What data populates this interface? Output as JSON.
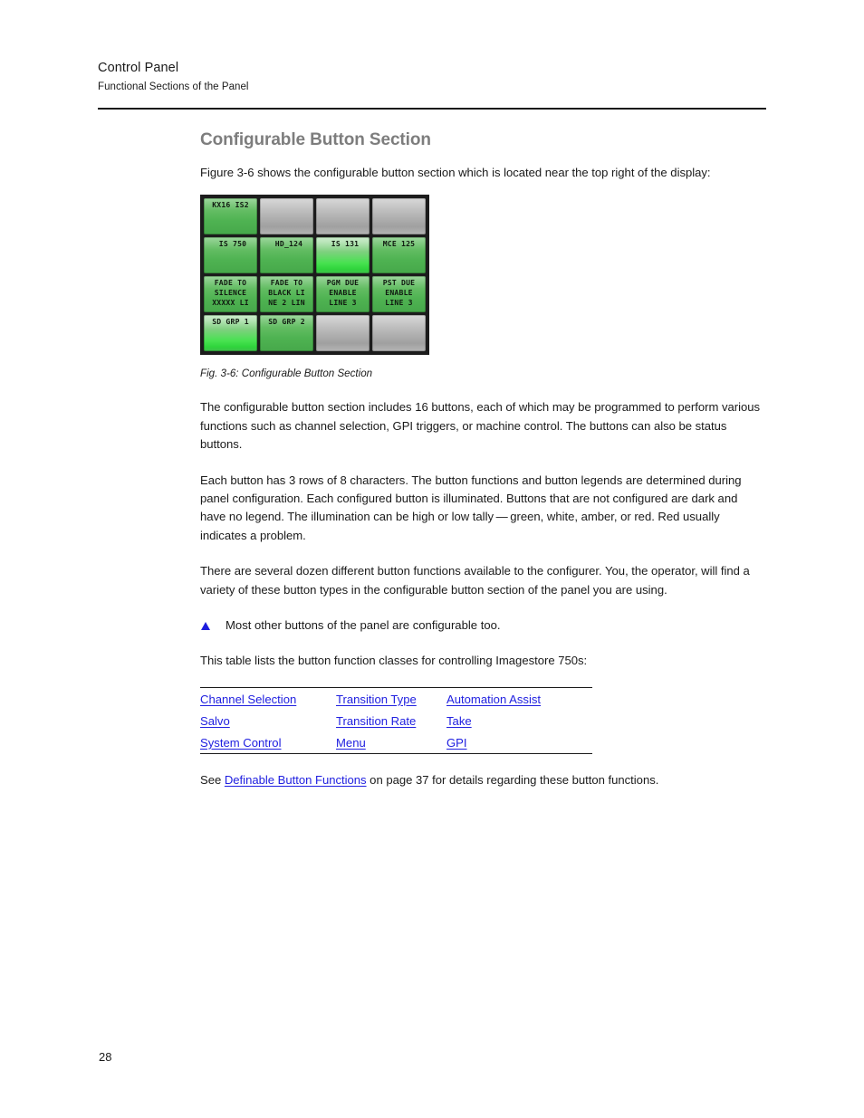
{
  "header": {
    "title": "Control Panel",
    "subtitle": "Functional Sections of the Panel"
  },
  "section": {
    "heading": "Configurable Button Section",
    "intro": "Figure 3-6 shows the configurable button section which is located near the top right of the display:",
    "caption": "Fig. 3-6: Configurable Button Section",
    "para1": "The configurable button section includes 16 buttons, each of which may be programmed to perform various functions such as channel selection, GPI triggers, or machine control. The buttons can also be status buttons.",
    "para2": "Each button has 3 rows of 8 characters. The button functions and button legends are determined during panel configuration. Each configured button is illuminated. Buttons that are not configured are dark and have no legend. The illumination can be high or low tally — green, white, amber, or red. Red usually indicates a problem.",
    "para3": "There are several dozen different button functions available to the configurer. You, the operator, will find a variety of these button types in the configurable button section of the panel you are using.",
    "note": "Most other buttons of the panel are configurable too.",
    "table_intro": "This table lists the button function classes for controlling Imagestore 750s:",
    "see_prefix": "See ",
    "see_link": "Definable Button Functions",
    "see_suffix": " on page 37 for details regarding these button functions."
  },
  "figure": {
    "panel_background": "#1c1c1c",
    "buttons": [
      {
        "state": "green",
        "lines": "KX16 IS2"
      },
      {
        "state": "gray",
        "lines": ""
      },
      {
        "state": "gray",
        "lines": ""
      },
      {
        "state": "gray",
        "lines": ""
      },
      {
        "state": "green",
        "lines": " IS 750"
      },
      {
        "state": "green",
        "lines": " HD_124"
      },
      {
        "state": "green-hi",
        "lines": " IS 131"
      },
      {
        "state": "green",
        "lines": "MCE 125"
      },
      {
        "state": "green",
        "lines": "FADE TO\nSILENCE\nXXXXX LI"
      },
      {
        "state": "green",
        "lines": "FADE TO\nBLACK LI\nNE 2 LIN"
      },
      {
        "state": "green",
        "lines": "PGM DUE\nENABLE\nLINE 3"
      },
      {
        "state": "green",
        "lines": "PST DUE\nENABLE\nLINE 3"
      },
      {
        "state": "green-hi",
        "lines": "SD GRP 1"
      },
      {
        "state": "green",
        "lines": "SD GRP 2"
      },
      {
        "state": "gray",
        "lines": ""
      },
      {
        "state": "gray",
        "lines": ""
      }
    ]
  },
  "link_table": {
    "rows": [
      [
        "Channel Selection",
        "Transition Type",
        "Automation Assist"
      ],
      [
        "Salvo",
        "Transition Rate",
        "Take"
      ],
      [
        "System Control",
        "Menu",
        "GPI"
      ]
    ]
  },
  "folio": {
    "page_number": "28"
  },
  "colors": {
    "heading": "#7d7d7d",
    "link": "#2020e0",
    "note_bullet": "#1d1ddd",
    "rule": "#1a1a1a",
    "button_green": "#4fb352",
    "button_green_high": "#46e24f",
    "button_gray": "#b6b6b6"
  }
}
